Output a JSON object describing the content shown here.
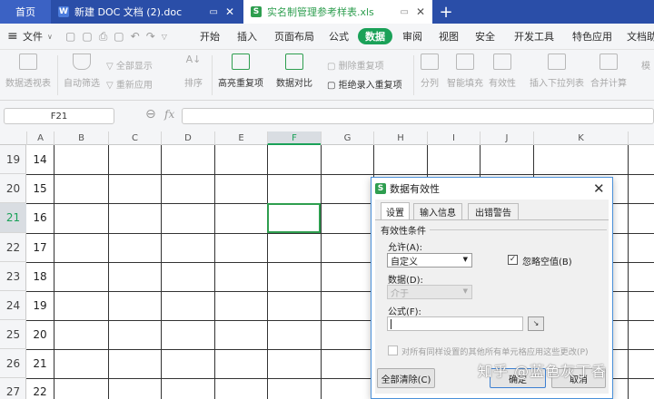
{
  "tabs": {
    "home": "首页",
    "doc": "新建 DOC 文档 (2).doc",
    "xls": "实名制管理参考样表.xls",
    "doc_icon_letter": "W",
    "xls_icon_letter": "S",
    "add_symbol": "+",
    "close_symbol": "✕",
    "monitor_symbol": "▭"
  },
  "menu": {
    "menu_symbol": "≡",
    "file": "文件",
    "items": [
      "开始",
      "插入",
      "页面布局",
      "公式",
      "数据",
      "审阅",
      "视图",
      "安全",
      "开发工具",
      "特色应用",
      "文档助"
    ],
    "active_index": 4
  },
  "ribbon": {
    "pivot": "数据透视表",
    "autofilter": "自动筛选",
    "show_all": "全部显示",
    "reapply": "重新应用",
    "sort": "排序",
    "highlight_dup": "高亮重复项",
    "data_compare": "数据对比",
    "delete_dup": "删除重复项",
    "reject_dup": "拒绝录入重复项",
    "split": "分列",
    "smart_fill": "智能填充",
    "validity": "有效性",
    "dropdown": "插入下拉列表",
    "merge_calc": "合并计算",
    "mo": "模"
  },
  "formula_bar": {
    "name_box": "F21",
    "fx": "fx",
    "zoom_symbol": "⊖"
  },
  "sheet": {
    "columns": [
      "A",
      "B",
      "C",
      "D",
      "E",
      "F",
      "G",
      "H",
      "I",
      "J",
      "K"
    ],
    "rows": [
      "19",
      "20",
      "21",
      "22",
      "23",
      "24",
      "25",
      "26",
      "27"
    ],
    "col_a_values": [
      "14",
      "15",
      "16",
      "17",
      "18",
      "19",
      "20",
      "21",
      "22"
    ],
    "selected_cell": "F21",
    "selected_column": "F",
    "selected_row": "21"
  },
  "dialog": {
    "title": "数据有效性",
    "icon_letter": "S",
    "close_symbol": "✕",
    "tabs": [
      "设置",
      "输入信息",
      "出错警告"
    ],
    "active_tab": 0,
    "section": "有效性条件",
    "allow_label": "允许(A):",
    "allow_value": "自定义",
    "ignore_blank": "忽略空值(B)",
    "ignore_blank_checked": true,
    "data_label": "数据(D):",
    "data_value": "介于",
    "formula_label": "公式(F):",
    "formula_value": "",
    "apply_all": "对所有同样设置的其他所有单元格应用这些更改(P)",
    "clear_all": "全部清除(C)",
    "ok": "确定",
    "cancel": "取消"
  },
  "watermark": "知乎 @蓝色灰丁香"
}
